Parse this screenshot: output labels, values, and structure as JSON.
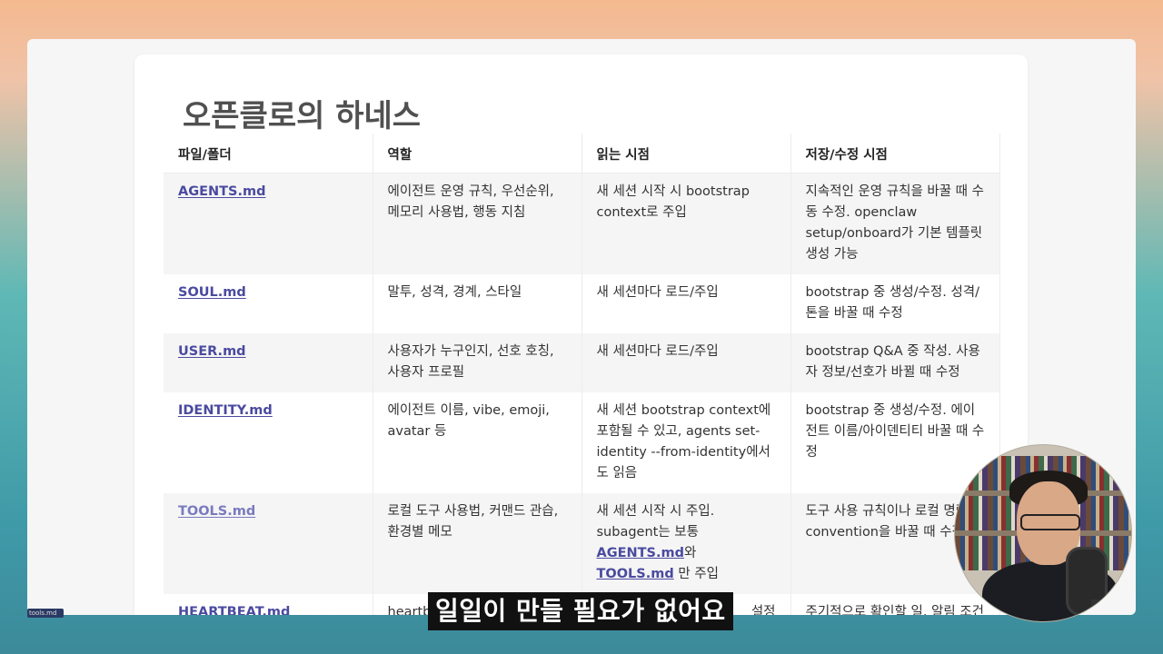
{
  "title": "오픈클로의 하네스",
  "table": {
    "headers": [
      "파일/폴더",
      "역할",
      "읽는 시점",
      "저장/수정 시점"
    ],
    "rows": [
      {
        "file": "AGENTS.md",
        "role": "에이전트 운영 규칙, 우선순위, 메모리 사용법, 행동 지침",
        "read": "새 세션 시작 시 bootstrap context로 주입",
        "save": "지속적인 운영 규칙을 바꿀 때 수동 수정. openclaw setup/onboard가 기본 템플릿 생성 가능"
      },
      {
        "file": "SOUL.md",
        "role": "말투, 성격, 경계, 스타일",
        "read": "새 세션마다 로드/주입",
        "save": "bootstrap 중 생성/수정. 성격/톤을 바꿀 때 수정"
      },
      {
        "file": "USER.md",
        "role": "사용자가 누구인지, 선호 호칭, 사용자 프로필",
        "read": "새 세션마다 로드/주입",
        "save": "bootstrap Q&A 중 작성. 사용자 정보/선호가 바뀔 때 수정"
      },
      {
        "file": "IDENTITY.md",
        "role": "에이전트 이름, vibe, emoji, avatar 등",
        "read": "새 세션 bootstrap context에 포함될 수 있고, agents set-identity --from-identity에서도 읽음",
        "save": "bootstrap 중 생성/수정. 에이전트 이름/아이덴티티 바꿀 때 수정"
      },
      {
        "file": "TOOLS.md",
        "role": "로컬 도구 사용법, 커맨드 관습, 환경별 메모",
        "read_prefix": "새 세션 시작 시 주입. subagent는 보통",
        "read_link1": "AGENTS.md",
        "read_mid": "와",
        "read_link2": "TOOLS.md",
        "read_suffix": "만 주입",
        "save": "도구 사용 규칙이나 로컬 명령 convention을 바꿀 때 수정"
      },
      {
        "file": "HEARTBEAT.md",
        "role": "heartbeat",
        "read": "설정",
        "save": "주기적으로 확인할 일, 알림 조건"
      }
    ]
  },
  "subtitle": "일일이 만들 필요가 없어요",
  "taskbar_label": "tools.md"
}
